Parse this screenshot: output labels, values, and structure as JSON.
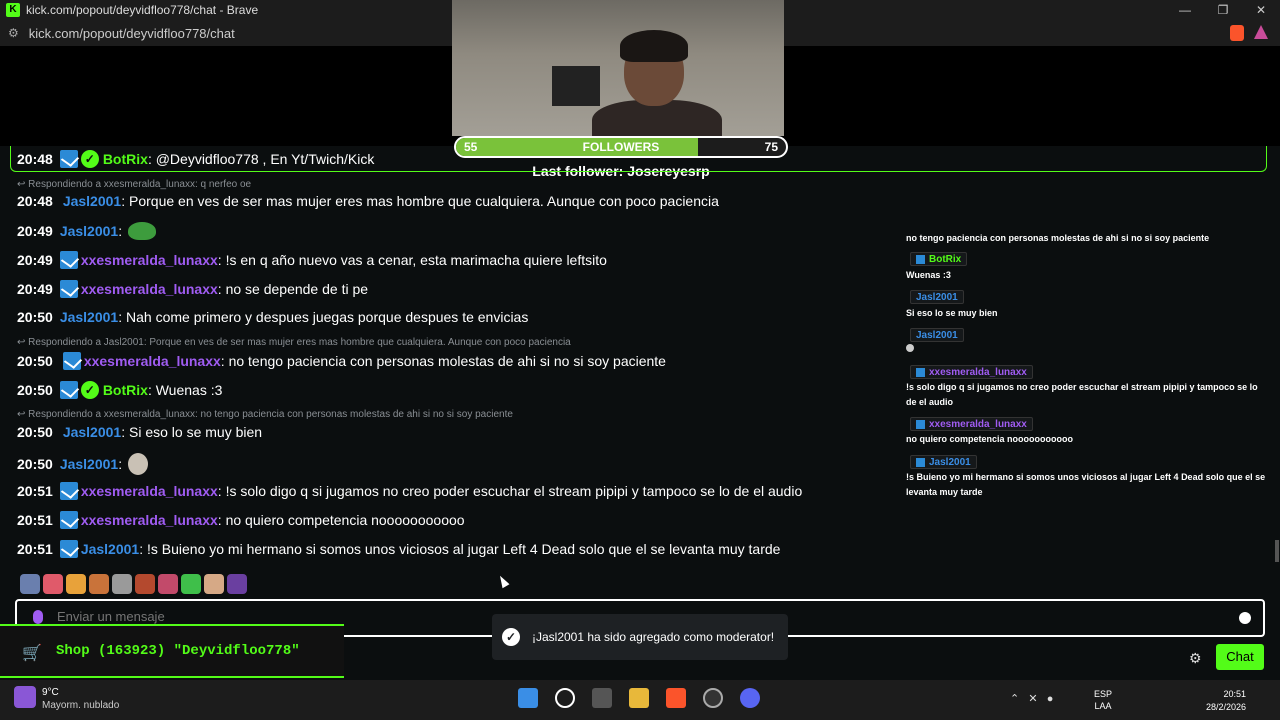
{
  "browser": {
    "title": "kick.com/popout/deyvidfloo778/chat - Brave",
    "url": "kick.com/popout/deyvidfloo778/chat",
    "minimize": "—",
    "restore": "❐",
    "close": "✕"
  },
  "followers_goal": {
    "current": "55",
    "label": "FOLLOWERS",
    "target": "75",
    "progress": 0.733,
    "last_follower": "Last follower: Josereyesrp"
  },
  "pinned": {
    "time": "20:48",
    "user": "BotRix",
    "text": ": @Deyvidfloo778 , En Yt/Twich/Kick"
  },
  "messages": [
    {
      "reply": "Respondiendo a xxesmeralda_lunaxx: q nerfeo oe"
    },
    {
      "time": "20:48",
      "user": "Jasl2001",
      "text": ": Porque en ves de ser mas mujer eres mas hombre que cualquiera. Aunque con poco paciencia"
    },
    {
      "time": "20:49",
      "user": "Jasl2001",
      "text": ":"
    },
    {
      "time": "20:49",
      "user": "xxesmeralda_lunaxx",
      "text": ": !s en q año nuevo vas a cenar, esta marimacha quiere leftsito"
    },
    {
      "time": "20:49",
      "user": "xxesmeralda_lunaxx",
      "text": ": no se depende de ti pe"
    },
    {
      "time": "20:50",
      "user": "Jasl2001",
      "text": ": Nah come primero y despues juegas porque despues te envicias"
    },
    {
      "reply": "Respondiendo a Jasl2001: Porque en ves de ser mas mujer eres mas hombre que cualquiera. Aunque con poco paciencia"
    },
    {
      "time": "20:50",
      "user": "xxesmeralda_lunaxx",
      "text": ": no tengo paciencia con personas molestas de ahi si no si soy paciente"
    },
    {
      "time": "20:50",
      "user": "BotRix",
      "text": ": Wuenas :3"
    },
    {
      "reply": "Respondiendo a xxesmeralda_lunaxx: no tengo paciencia con personas molestas de ahi si no si soy paciente"
    },
    {
      "time": "20:50",
      "user": "Jasl2001",
      "text": ": Si eso lo se muy bien"
    },
    {
      "time": "20:50",
      "user": "Jasl2001",
      "text": ":"
    },
    {
      "time": "20:51",
      "user": "xxesmeralda_lunaxx",
      "text": ": !s solo digo q si jugamos no creo poder escuchar el stream pipipi y tampoco se lo de el audio"
    },
    {
      "time": "20:51",
      "user": "xxesmeralda_lunaxx",
      "text": ": no quiero competencia nooooooooooo"
    },
    {
      "time": "20:51",
      "user": "Jasl2001",
      "text": ": !s Buieno yo mi hermano si somos unos viciosos al jugar Left 4 Dead solo que el se levanta muy tarde"
    }
  ],
  "overlay": [
    {
      "text": "no tengo paciencia con personas molestas de ahi si no si soy paciente"
    },
    {
      "user": "BotRix",
      "text": "Wuenas :3"
    },
    {
      "user": "Jasl2001",
      "text": "Si eso lo se muy bien"
    },
    {
      "user": "Jasl2001",
      "text": ""
    },
    {
      "user": "xxesmeralda_lunaxx",
      "text": "!s solo digo q si jugamos no creo poder escuchar el stream pipipi y tampoco se lo de el audio"
    },
    {
      "user": "xxesmeralda_lunaxx",
      "text": "no quiero competencia nooooooooooo"
    },
    {
      "user": "Jasl2001",
      "text": "!s Buieno yo mi hermano si somos unos viciosos al jugar Left 4 Dead solo que el se levanta muy tarde"
    }
  ],
  "input": {
    "placeholder": "Enviar un mensaje"
  },
  "shop": {
    "text": "Shop (163923) \"Deyvidfloo778\""
  },
  "toast": {
    "text": "¡Jasl2001 ha sido agregado como moderator!"
  },
  "chat_button": "Chat",
  "taskbar": {
    "temp": "9°C",
    "weather": "Mayorm. nublado",
    "lang1": "ESP",
    "lang2": "LAA",
    "time": "20:51",
    "date": "28/2/2026"
  },
  "colors": {
    "kick_green": "#53fc18",
    "user_blue": "#3a8ee6",
    "user_purple": "#a05cf2",
    "mod_badge": "#2b8ad6"
  }
}
